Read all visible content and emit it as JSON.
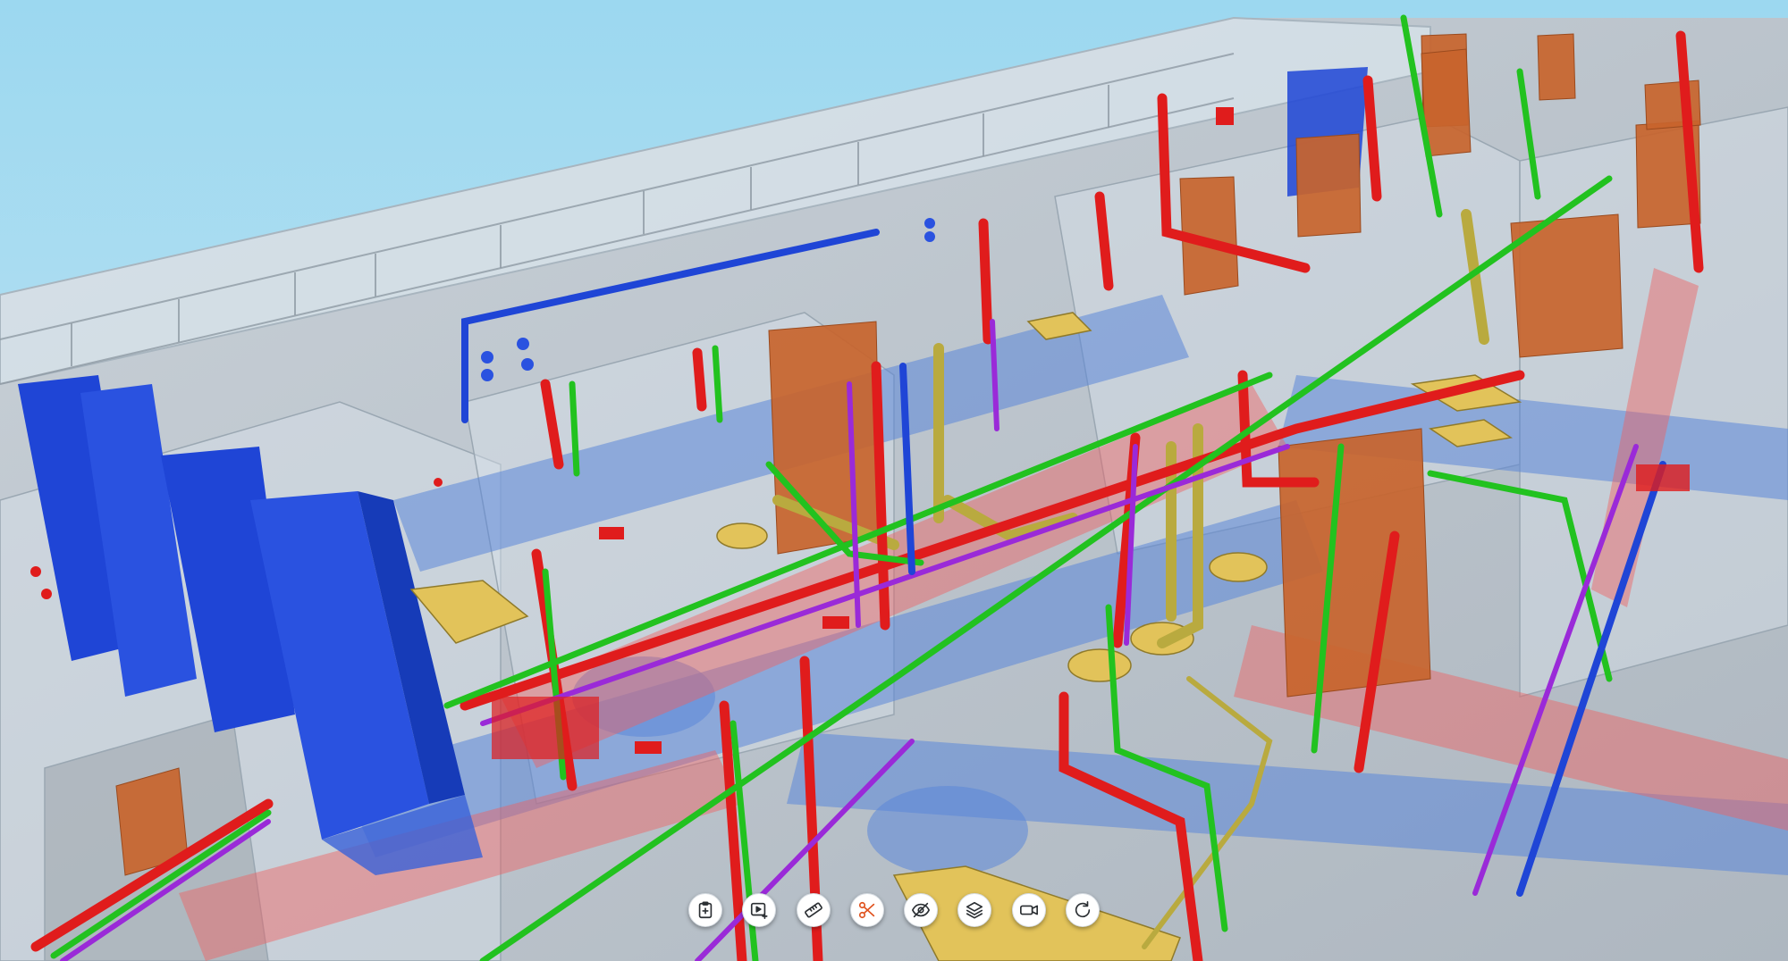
{
  "viewer": {
    "scene": "bim-mep-model-3d-view",
    "colors": {
      "sky_top": "#9cd8f0",
      "sky_bottom": "#c9e6f2",
      "ground": "#b8c1ca",
      "glass": "#cfd9e2",
      "heating_pipe": "#e01c1c",
      "cold_water_pipe": "#22c21f",
      "hot_water_pipe": "#9a2ad8",
      "drain_pipe": "#b9aa3f",
      "supply_duct": "#1f45d6",
      "light_duct": "#5b86d8",
      "exhaust_duct": "#f06060",
      "equipment": "#c8642c",
      "fixture": "#e2c35a"
    }
  },
  "toolbar": {
    "buttons": [
      {
        "id": "clipboard-add",
        "icon": "clipboard-add-icon",
        "active": false
      },
      {
        "id": "screen-add",
        "icon": "screen-add-icon",
        "active": false
      },
      {
        "id": "measure",
        "icon": "ruler-icon",
        "active": false
      },
      {
        "id": "cut",
        "icon": "scissors-icon",
        "active": true
      },
      {
        "id": "hide",
        "icon": "eye-off-icon",
        "active": false
      },
      {
        "id": "layers",
        "icon": "layers-icon",
        "active": false
      },
      {
        "id": "camera",
        "icon": "video-camera-icon",
        "active": false
      },
      {
        "id": "reset-view",
        "icon": "rotate-icon",
        "active": false
      }
    ],
    "accent_color": "#e0531f"
  }
}
